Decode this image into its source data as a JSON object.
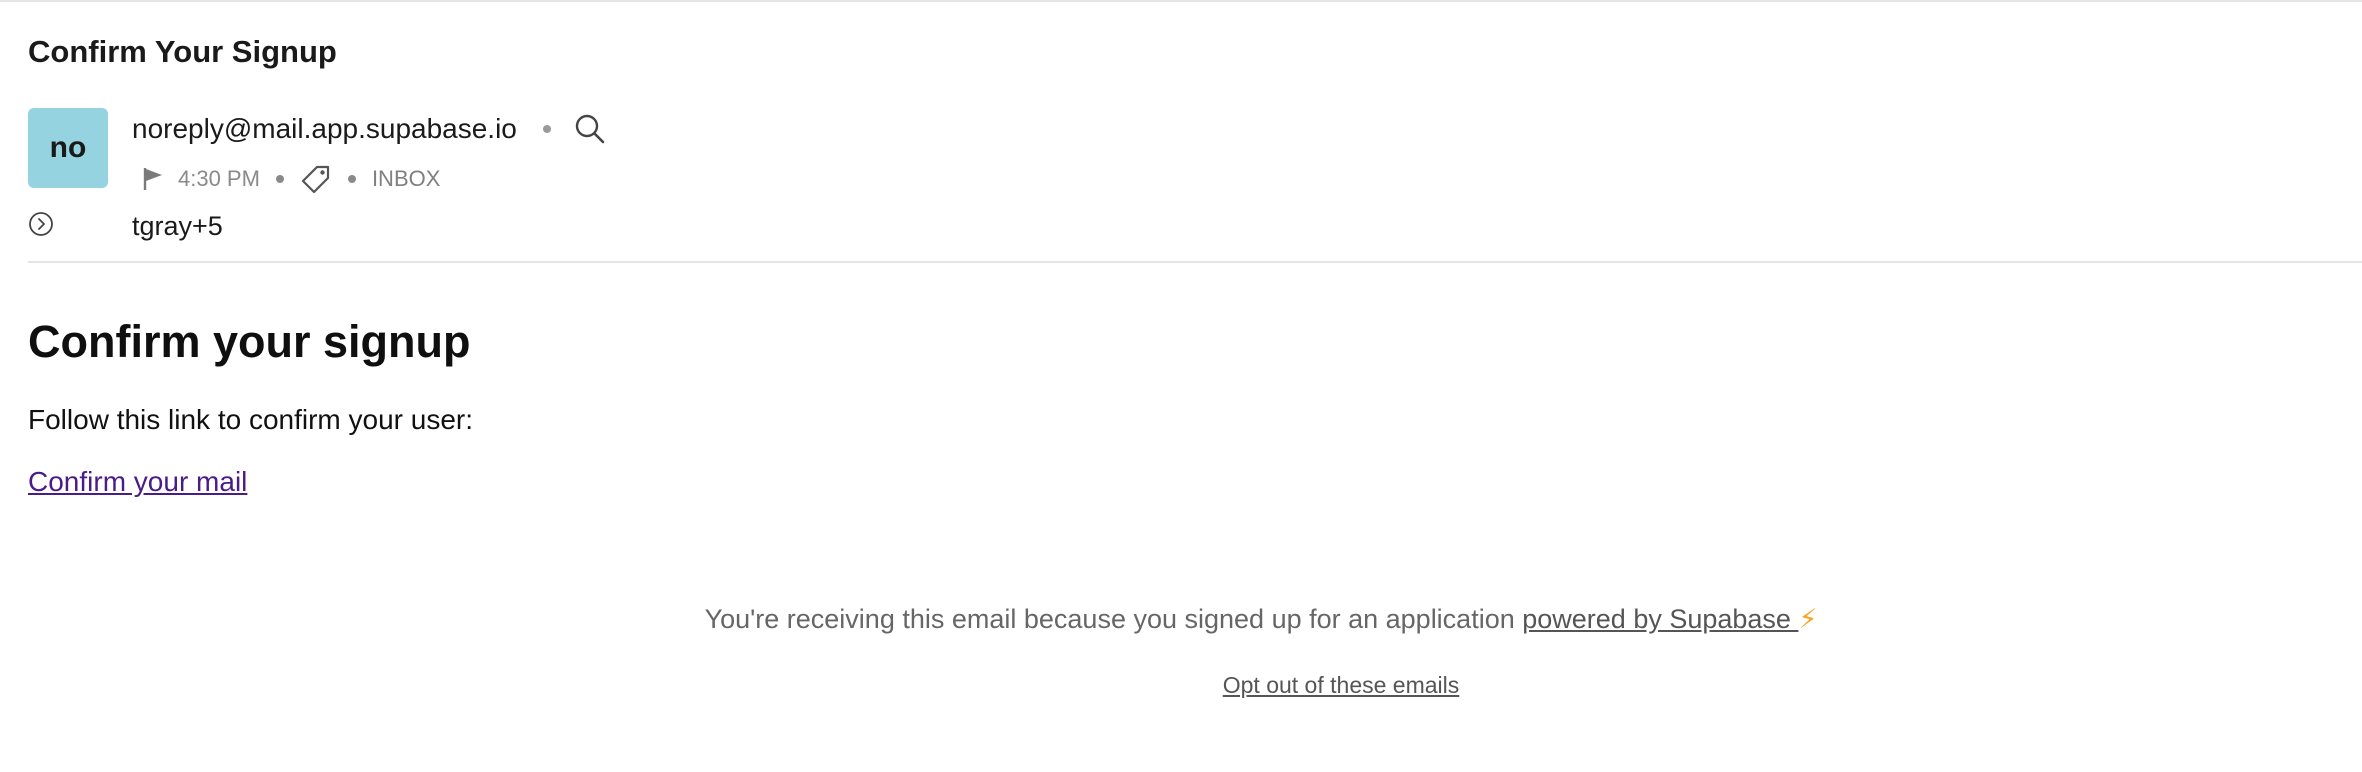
{
  "email": {
    "subject": "Confirm Your Signup",
    "avatar_initials": "no",
    "sender": "noreply@mail.app.supabase.io",
    "time": "4:30 PM",
    "folder": "INBOX",
    "recipients": "tgray+5"
  },
  "body": {
    "title": "Confirm your signup",
    "text": "Follow this link to confirm your user:",
    "link_label": "Confirm your mail"
  },
  "footer": {
    "text": "You're receiving this email because you signed up for an application ",
    "link_label": "powered by Supabase ",
    "bolt": "⚡",
    "optout_label": "Opt out of these emails"
  },
  "icons": {
    "search": "search-icon",
    "flag": "flag-icon",
    "tag": "tag-icon",
    "expand": "chevron-right-circle-icon"
  },
  "colors": {
    "avatar_bg": "#95d3e0",
    "link": "#4a1c8a",
    "bolt": "#f5a623"
  }
}
